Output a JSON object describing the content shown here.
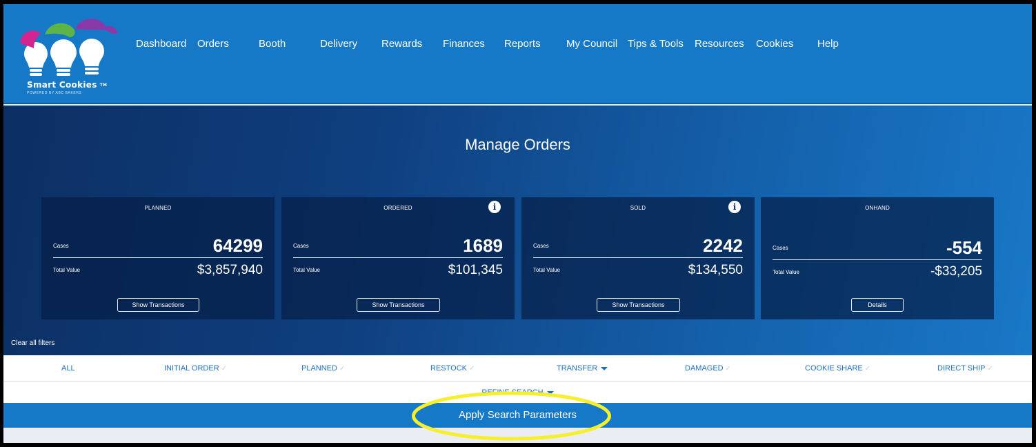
{
  "logo": {
    "name": "Smart Cookies",
    "tm": "TM",
    "tagline": "POWERED BY ABC BAKERS"
  },
  "nav": {
    "items": [
      "Dashboard",
      "Orders",
      "Booth",
      "Delivery",
      "Rewards",
      "Finances",
      "Reports",
      "My Council",
      "Tips & Tools",
      "Resources",
      "Cookies",
      "Help"
    ]
  },
  "page": {
    "title": "Manage Orders"
  },
  "cards": [
    {
      "heading": "PLANNED",
      "cases_label": "Cases",
      "cases": "64299",
      "value_label": "Total Value",
      "value": "$3,857,940",
      "button": "Show Transactions",
      "info": false
    },
    {
      "heading": "ORDERED",
      "cases_label": "Cases",
      "cases": "1689",
      "value_label": "Total Value",
      "value": "$101,345",
      "button": "Show Transactions",
      "info": true
    },
    {
      "heading": "SOLD",
      "cases_label": "Cases",
      "cases": "2242",
      "value_label": "Total Value",
      "value": "$134,550",
      "button": "Show Transactions",
      "info": true
    },
    {
      "heading": "ONHAND",
      "cases_label": "Cases",
      "cases": "-554",
      "value_label": "Total Value",
      "value": "-$33,205",
      "button": "Details",
      "info": false
    }
  ],
  "filters": {
    "clear_label": "Clear all filters",
    "items": [
      "ALL",
      "INITIAL ORDER",
      "PLANNED",
      "RESTOCK",
      "TRANSFER",
      "DAMAGED",
      "COOKIE SHARE",
      "DIRECT SHIP"
    ],
    "refine_label": "REFINE SEARCH",
    "apply_label": "Apply Search Parameters"
  },
  "icons": {
    "info": "info-circle-icon",
    "check": "check-icon",
    "caret": "caret-down-icon"
  },
  "colors": {
    "brand_blue": "#1679c7",
    "hero_dark": "#0c2f63",
    "highlight": "#f5ef2d",
    "filter_text": "#1f6fc0"
  }
}
